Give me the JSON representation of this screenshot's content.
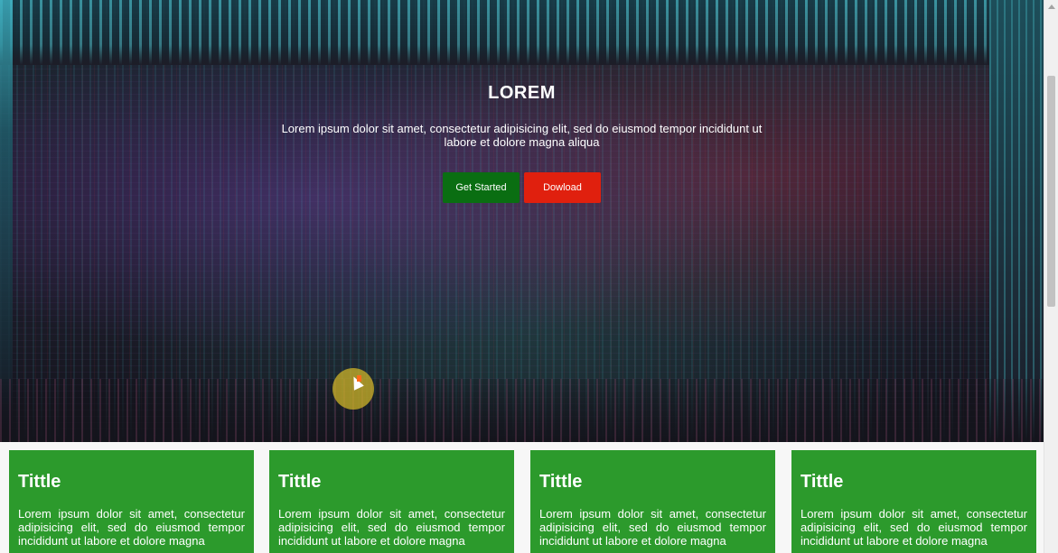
{
  "hero": {
    "title": "LOREM",
    "text": "Lorem ipsum dolor sit amet, consectetur adipisicing elit, sed do eiusmod tempor incididunt ut labore et dolore magna aliqua",
    "get_started_label": "Get Started",
    "download_label": "Dowload"
  },
  "cards": [
    {
      "title": "Tittle",
      "text": "Lorem ipsum dolor sit amet, consectetur adipisicing elit, sed do eiusmod tempor incididunt ut labore et dolore magna"
    },
    {
      "title": "Tittle",
      "text": "Lorem ipsum dolor sit amet, consectetur adipisicing elit, sed do eiusmod tempor incididunt ut labore et dolore magna"
    },
    {
      "title": "Tittle",
      "text": "Lorem ipsum dolor sit amet, consectetur adipisicing elit, sed do eiusmod tempor incididunt ut labore et dolore magna"
    },
    {
      "title": "Tittle",
      "text": "Lorem ipsum dolor sit amet, consectetur adipisicing elit, sed do eiusmod tempor incididunt ut labore et dolore magna"
    }
  ],
  "colors": {
    "start_button": "#0a6e12",
    "download_button": "#e0200e",
    "card_background": "#2c9a2c"
  },
  "icons": {
    "cursor": "mouse-cursor-icon"
  }
}
